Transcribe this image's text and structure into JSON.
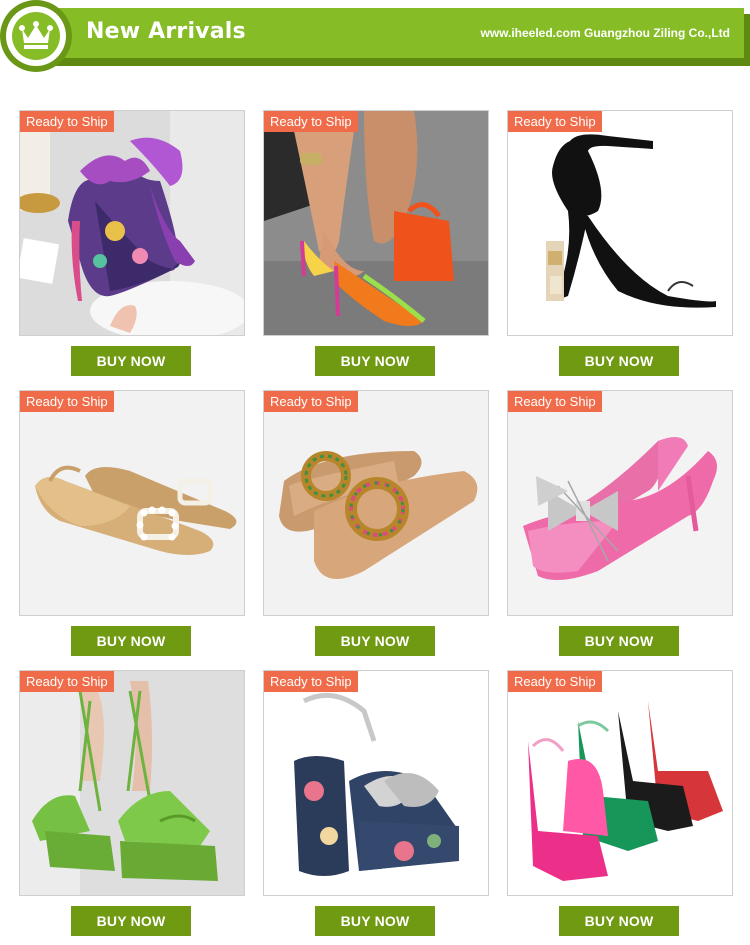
{
  "header": {
    "title": "New Arrivals",
    "site_text": "www.iheeled.com Guangzhou Ziling Co.,Ltd",
    "logo_icon": "crown-icon",
    "brand_green": "#86bd26",
    "dark_green": "#6f9a12"
  },
  "badge_color": "#ef6b4a",
  "products": [
    {
      "badge": "Ready to Ship",
      "button": "BUY NOW",
      "image": "purple floral platform heels with bow"
    },
    {
      "badge": "Ready to Ship",
      "button": "BUY NOW",
      "image": "neon pointed toe pumps"
    },
    {
      "badge": "Ready to Ship",
      "button": "BUY NOW",
      "image": "black ankle strap sculptural heel sandal"
    },
    {
      "badge": "Ready to Ship",
      "button": "BUY NOW",
      "image": "woven slingback flats with pearl buckle"
    },
    {
      "badge": "Ready to Ship",
      "button": "BUY NOW",
      "image": "tan slides with jeweled ring"
    },
    {
      "badge": "Ready to Ship",
      "button": "BUY NOW",
      "image": "pink slingback kitten heels with crystal bow"
    },
    {
      "badge": "Ready to Ship",
      "button": "BUY NOW",
      "image": "green lace-up platform heels"
    },
    {
      "badge": "Ready to Ship",
      "button": "BUY NOW",
      "image": "floral block heel platform with silver knot"
    },
    {
      "badge": "Ready to Ship",
      "button": "BUY NOW",
      "image": "satin platform block heels in colors"
    }
  ]
}
